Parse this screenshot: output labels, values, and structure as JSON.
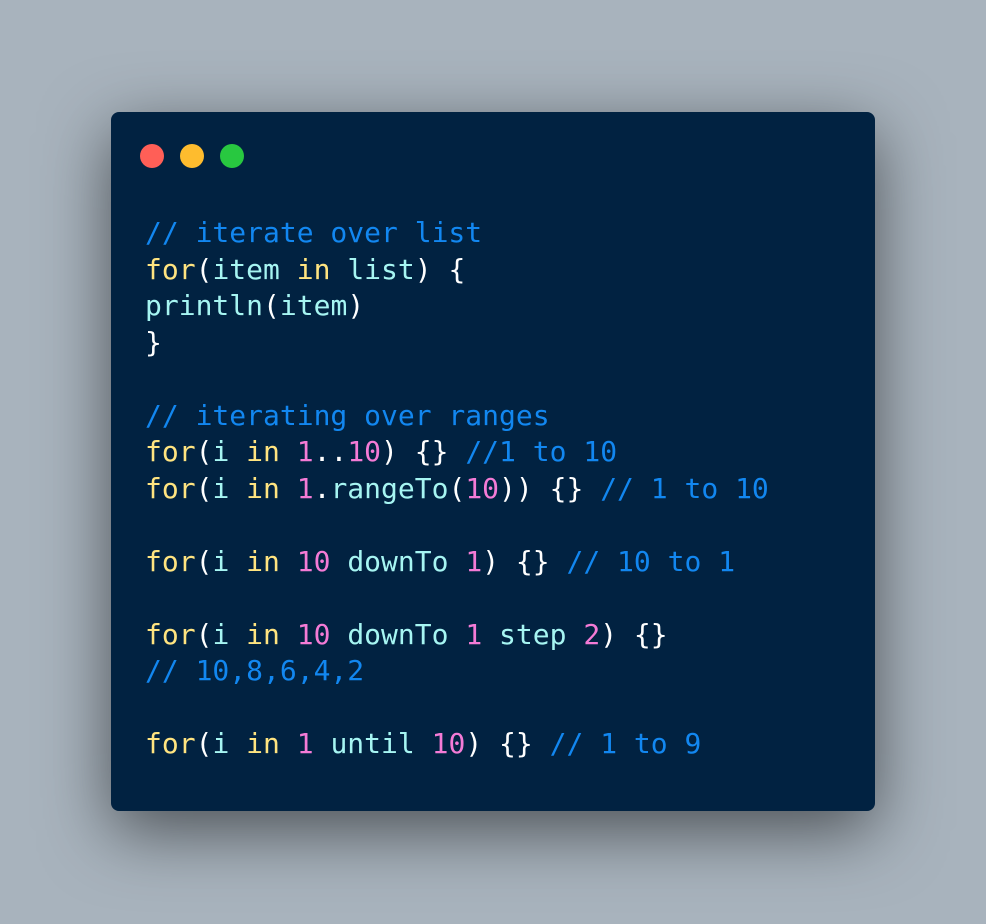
{
  "window": {
    "controls": [
      {
        "name": "close",
        "color": "#ff5f57"
      },
      {
        "name": "minimize",
        "color": "#febc2e"
      },
      {
        "name": "maximize",
        "color": "#28c840"
      }
    ]
  },
  "theme": {
    "background": "#a8b3bd",
    "editor_background": "#012241",
    "comment": "#1287f0",
    "keyword": "#ffe480",
    "identifier": "#a6f5f2",
    "number": "#f47bd6",
    "punctuation": "#ffffff"
  },
  "code": {
    "language": "kotlin",
    "lines": [
      [
        {
          "t": "comment",
          "v": "// iterate over list"
        }
      ],
      [
        {
          "t": "keyword",
          "v": "for"
        },
        {
          "t": "punct",
          "v": "("
        },
        {
          "t": "ident",
          "v": "item"
        },
        {
          "t": "punct",
          "v": " "
        },
        {
          "t": "keyword",
          "v": "in"
        },
        {
          "t": "punct",
          "v": " "
        },
        {
          "t": "ident",
          "v": "list"
        },
        {
          "t": "punct",
          "v": ") {"
        }
      ],
      [
        {
          "t": "ident",
          "v": "println"
        },
        {
          "t": "punct",
          "v": "("
        },
        {
          "t": "ident",
          "v": "item"
        },
        {
          "t": "punct",
          "v": ")"
        }
      ],
      [
        {
          "t": "punct",
          "v": "}"
        }
      ],
      [],
      [
        {
          "t": "comment",
          "v": "// iterating over ranges"
        }
      ],
      [
        {
          "t": "keyword",
          "v": "for"
        },
        {
          "t": "punct",
          "v": "("
        },
        {
          "t": "ident",
          "v": "i"
        },
        {
          "t": "punct",
          "v": " "
        },
        {
          "t": "keyword",
          "v": "in"
        },
        {
          "t": "punct",
          "v": " "
        },
        {
          "t": "number",
          "v": "1"
        },
        {
          "t": "punct",
          "v": ".."
        },
        {
          "t": "number",
          "v": "10"
        },
        {
          "t": "punct",
          "v": ") {} "
        },
        {
          "t": "comment",
          "v": "//1 to 10"
        }
      ],
      [
        {
          "t": "keyword",
          "v": "for"
        },
        {
          "t": "punct",
          "v": "("
        },
        {
          "t": "ident",
          "v": "i"
        },
        {
          "t": "punct",
          "v": " "
        },
        {
          "t": "keyword",
          "v": "in"
        },
        {
          "t": "punct",
          "v": " "
        },
        {
          "t": "number",
          "v": "1"
        },
        {
          "t": "punct",
          "v": "."
        },
        {
          "t": "ident",
          "v": "rangeTo"
        },
        {
          "t": "punct",
          "v": "("
        },
        {
          "t": "number",
          "v": "10"
        },
        {
          "t": "punct",
          "v": ")) {} "
        },
        {
          "t": "comment",
          "v": "// 1 to 10"
        }
      ],
      [],
      [
        {
          "t": "keyword",
          "v": "for"
        },
        {
          "t": "punct",
          "v": "("
        },
        {
          "t": "ident",
          "v": "i"
        },
        {
          "t": "punct",
          "v": " "
        },
        {
          "t": "keyword",
          "v": "in"
        },
        {
          "t": "punct",
          "v": " "
        },
        {
          "t": "number",
          "v": "10"
        },
        {
          "t": "punct",
          "v": " "
        },
        {
          "t": "ident",
          "v": "downTo"
        },
        {
          "t": "punct",
          "v": " "
        },
        {
          "t": "number",
          "v": "1"
        },
        {
          "t": "punct",
          "v": ") {} "
        },
        {
          "t": "comment",
          "v": "// 10 to 1"
        }
      ],
      [],
      [
        {
          "t": "keyword",
          "v": "for"
        },
        {
          "t": "punct",
          "v": "("
        },
        {
          "t": "ident",
          "v": "i"
        },
        {
          "t": "punct",
          "v": " "
        },
        {
          "t": "keyword",
          "v": "in"
        },
        {
          "t": "punct",
          "v": " "
        },
        {
          "t": "number",
          "v": "10"
        },
        {
          "t": "punct",
          "v": " "
        },
        {
          "t": "ident",
          "v": "downTo"
        },
        {
          "t": "punct",
          "v": " "
        },
        {
          "t": "number",
          "v": "1"
        },
        {
          "t": "punct",
          "v": " "
        },
        {
          "t": "ident",
          "v": "step"
        },
        {
          "t": "punct",
          "v": " "
        },
        {
          "t": "number",
          "v": "2"
        },
        {
          "t": "punct",
          "v": ") {}"
        }
      ],
      [
        {
          "t": "comment",
          "v": "// 10,8,6,4,2"
        }
      ],
      [],
      [
        {
          "t": "keyword",
          "v": "for"
        },
        {
          "t": "punct",
          "v": "("
        },
        {
          "t": "ident",
          "v": "i"
        },
        {
          "t": "punct",
          "v": " "
        },
        {
          "t": "keyword",
          "v": "in"
        },
        {
          "t": "punct",
          "v": " "
        },
        {
          "t": "number",
          "v": "1"
        },
        {
          "t": "punct",
          "v": " "
        },
        {
          "t": "ident",
          "v": "until"
        },
        {
          "t": "punct",
          "v": " "
        },
        {
          "t": "number",
          "v": "10"
        },
        {
          "t": "punct",
          "v": ") {} "
        },
        {
          "t": "comment",
          "v": "// 1 to 9"
        }
      ]
    ]
  }
}
